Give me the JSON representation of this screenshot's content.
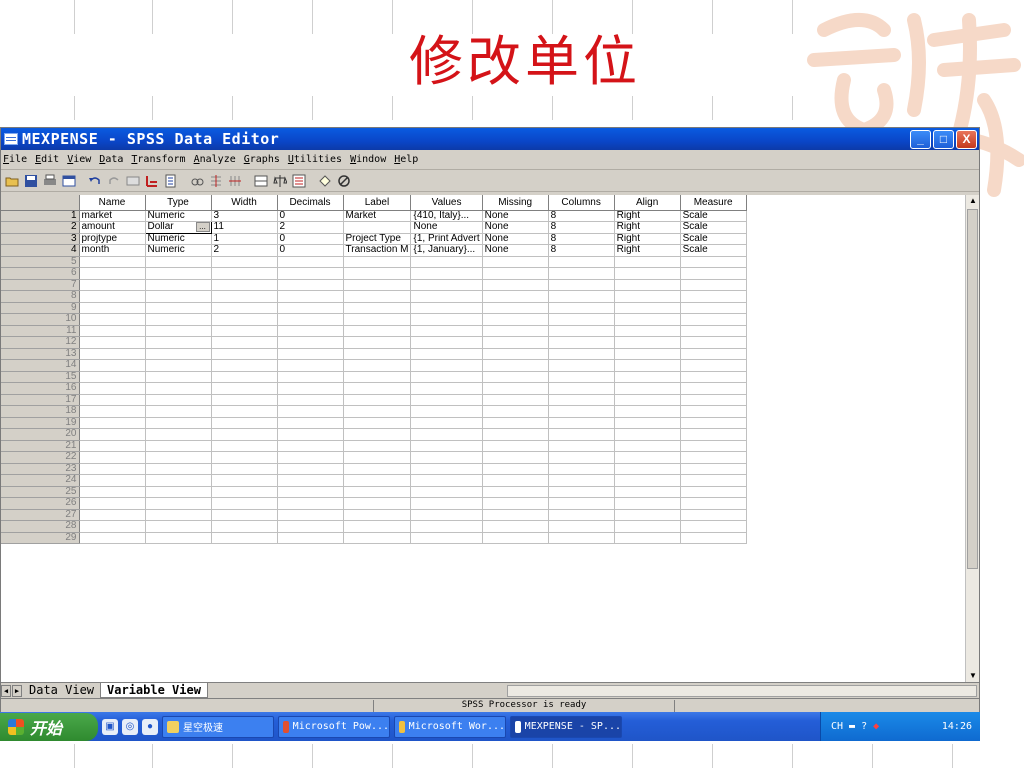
{
  "slide_title": "修改单位",
  "window": {
    "title": "MEXPENSE - SPSS Data Editor",
    "controls": {
      "minimize": "_",
      "maximize": "□",
      "close": "X"
    }
  },
  "menu": [
    "File",
    "Edit",
    "View",
    "Data",
    "Transform",
    "Analyze",
    "Graphs",
    "Utilities",
    "Window",
    "Help"
  ],
  "grid": {
    "columns": [
      "Name",
      "Type",
      "Width",
      "Decimals",
      "Label",
      "Values",
      "Missing",
      "Columns",
      "Align",
      "Measure"
    ],
    "rows": [
      [
        "market",
        "Numeric",
        "3",
        "0",
        "Market",
        "{410, Italy}...",
        "None",
        "8",
        "Right",
        "Scale"
      ],
      [
        "amount",
        "Dollar",
        "11",
        "2",
        "",
        "None",
        "None",
        "8",
        "Right",
        "Scale"
      ],
      [
        "projtype",
        "Numeric",
        "1",
        "0",
        "Project Type",
        "{1, Print Advert",
        "None",
        "8",
        "Right",
        "Scale"
      ],
      [
        "month",
        "Numeric",
        "2",
        "0",
        "Transaction M",
        "{1, January}...",
        "None",
        "8",
        "Right",
        "Scale"
      ]
    ],
    "active_cell_dots": "...",
    "row_numbers": [
      "1",
      "2",
      "3",
      "4",
      "5",
      "6",
      "7",
      "8",
      "9",
      "10",
      "11",
      "12",
      "13",
      "14",
      "15",
      "16",
      "17",
      "18",
      "19",
      "20",
      "21",
      "22",
      "23",
      "24",
      "25",
      "26",
      "27",
      "28",
      "29"
    ]
  },
  "tabs": {
    "data_view": "Data View",
    "variable_view": "Variable View"
  },
  "status": "SPSS Processor  is ready",
  "taskbar": {
    "start": "开始",
    "tasks": [
      "星空极速",
      "Microsoft Pow...",
      "Microsoft Wor...",
      "MEXPENSE - SP..."
    ],
    "tray_lang": "CH",
    "clock": "14:26"
  },
  "colors": {
    "title_red": "#d41318",
    "titlebar_blue": "#0a46c8",
    "chrome_gray": "#d4d0c8"
  }
}
